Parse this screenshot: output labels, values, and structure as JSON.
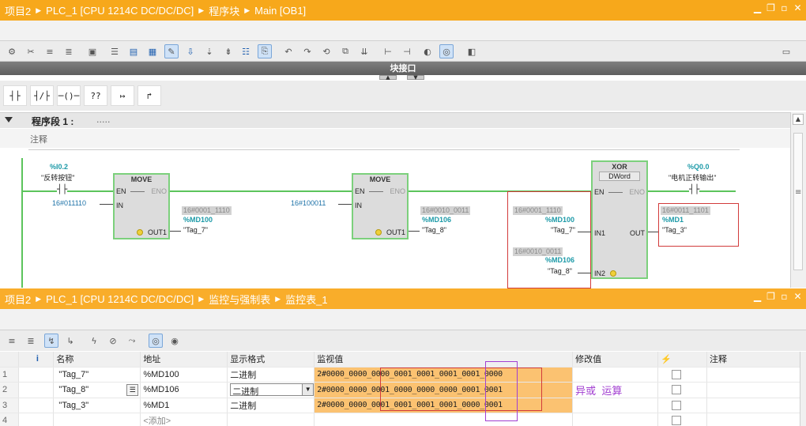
{
  "editor_title": {
    "crumbs": [
      "项目2",
      "PLC_1 [CPU 1214C DC/DC/DC]",
      "程序块",
      "Main [OB1]"
    ]
  },
  "interface_bar": {
    "label": "块接口"
  },
  "network": {
    "title": "程序段 1 :",
    "description": ".....",
    "comment": "注释"
  },
  "ladder": {
    "input_contact": {
      "address": "%I0.2",
      "tag": "\"反转按钮\""
    },
    "move1": {
      "title": "MOVE",
      "en": "EN",
      "eno": "ENO",
      "in": "IN",
      "out": "OUT1",
      "in_value": "16#011110",
      "out_monitor": "16#0001_1110",
      "out_address": "%MD100",
      "out_tag": "\"Tag_7\""
    },
    "move2": {
      "title": "MOVE",
      "en": "EN",
      "eno": "ENO",
      "in": "IN",
      "out": "OUT1",
      "in_value": "16#100011",
      "out_monitor": "16#0010_0011",
      "out_address": "%MD106",
      "out_tag": "\"Tag_8\""
    },
    "xor": {
      "title": "XOR",
      "type": "DWord",
      "en": "EN",
      "eno": "ENO",
      "in1": "IN1",
      "in2": "IN2",
      "out": "OUT",
      "in1_monitor": "16#0001_1110",
      "in1_address": "%MD100",
      "in1_tag": "\"Tag_7\"",
      "in2_monitor": "16#0010_0011",
      "in2_address": "%MD106",
      "in2_tag": "\"Tag_8\"",
      "out_monitor": "16#0011_1101",
      "out_address": "%MD1",
      "out_tag": "\"Tag_3\""
    },
    "output_coil": {
      "address": "%Q0.0",
      "tag": "\"电机正转输出\""
    }
  },
  "watch_title": {
    "crumbs": [
      "项目2",
      "PLC_1 [CPU 1214C DC/DC/DC]",
      "监控与强制表",
      "监控表_1"
    ]
  },
  "watch_table": {
    "headers": [
      "",
      "i",
      "名称",
      "地址",
      "显示格式",
      "监视值",
      "修改值",
      "⚡",
      "注释"
    ],
    "rows": [
      {
        "n": "1",
        "name": "\"Tag_7\"",
        "addr": "%MD100",
        "fmt": "二进制",
        "value": "2#0000_0000_0000_0001_0001_0001_0001_0000"
      },
      {
        "n": "2",
        "name": "\"Tag_8\"",
        "addr": "%MD106",
        "fmt": "二进制",
        "value": "2#0000_0000_0001_0000_0000_0000_0001_0001"
      },
      {
        "n": "3",
        "name": "\"Tag_3\"",
        "addr": "%MD1",
        "fmt": "二进制",
        "value": "2#0000_0000_0001_0001_0001_0001_0000_0001"
      },
      {
        "n": "4",
        "name": "",
        "addr": "<添加>",
        "fmt": "",
        "value": ""
      }
    ],
    "annotation": "异或  运算"
  },
  "colors": {
    "titlebar": "#f7a81b",
    "rung": "#5cc45c",
    "monitor_value": "#fbc271",
    "annotation": "#a23fd1"
  }
}
